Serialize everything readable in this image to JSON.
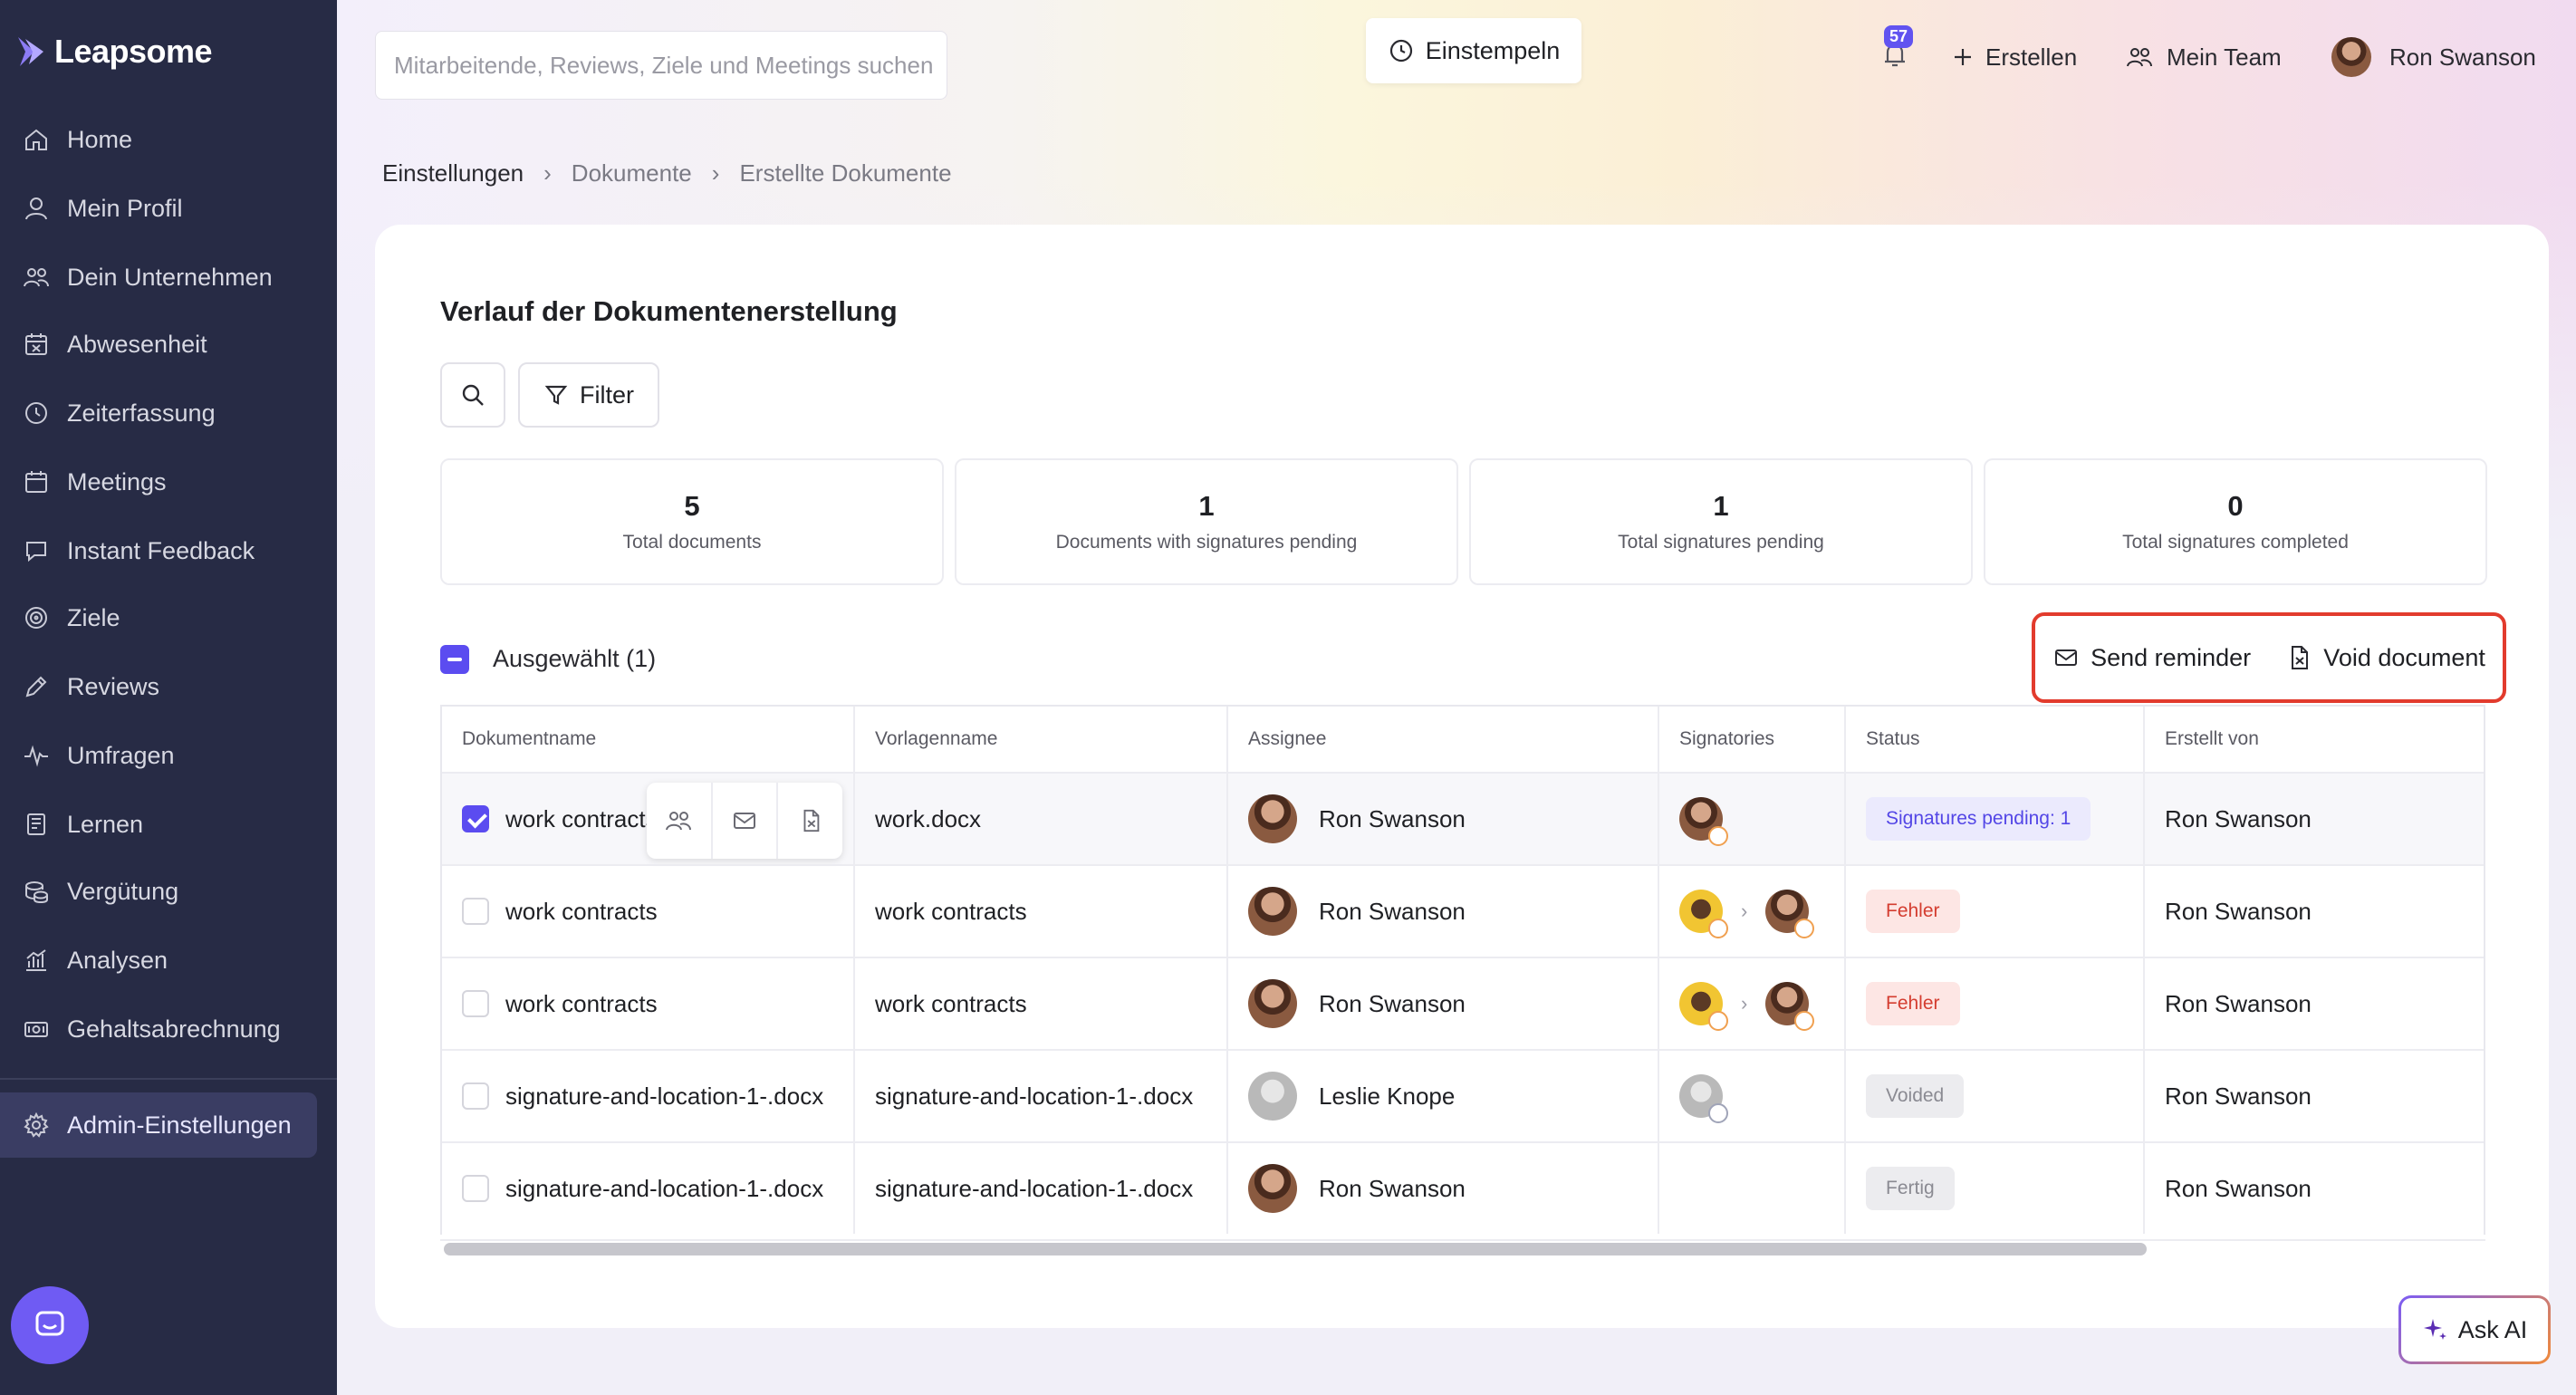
{
  "app": {
    "name": "Leapsome"
  },
  "sidebar": {
    "items": [
      {
        "label": "Home",
        "icon": "home-icon"
      },
      {
        "label": "Mein Profil",
        "icon": "user-icon"
      },
      {
        "label": "Dein Unternehmen",
        "icon": "users-icon"
      },
      {
        "label": "Abwesenheit",
        "icon": "calendar-x-icon"
      },
      {
        "label": "Zeiterfassung",
        "icon": "clock-icon"
      },
      {
        "label": "Meetings",
        "icon": "calendar-icon"
      },
      {
        "label": "Instant Feedback",
        "icon": "chat-icon"
      },
      {
        "label": "Ziele",
        "icon": "target-icon"
      },
      {
        "label": "Reviews",
        "icon": "pen-icon"
      },
      {
        "label": "Umfragen",
        "icon": "pulse-icon"
      },
      {
        "label": "Lernen",
        "icon": "book-icon"
      },
      {
        "label": "Vergütung",
        "icon": "coins-icon"
      },
      {
        "label": "Analysen",
        "icon": "chart-icon"
      },
      {
        "label": "Gehaltsabrechnung",
        "icon": "cash-icon"
      }
    ],
    "admin": {
      "label": "Admin-Einstellungen",
      "icon": "gear-icon"
    }
  },
  "topbar": {
    "search_placeholder": "Mitarbeitende, Reviews, Ziele und Meetings suchen",
    "clockin_label": "Einstempeln",
    "notifications_count": "57",
    "create_label": "Erstellen",
    "team_label": "Mein Team",
    "user_name": "Ron Swanson"
  },
  "breadcrumb": [
    "Einstellungen",
    "Dokumente",
    "Erstellte Dokumente"
  ],
  "page": {
    "title": "Verlauf der Dokumentenerstellung",
    "filter_label": "Filter",
    "stats": [
      {
        "value": "5",
        "label": "Total documents"
      },
      {
        "value": "1",
        "label": "Documents with signatures pending"
      },
      {
        "value": "1",
        "label": "Total signatures pending"
      },
      {
        "value": "0",
        "label": "Total signatures completed"
      }
    ],
    "selected_label": "Ausgewählt (1)",
    "send_reminder_label": "Send reminder",
    "void_document_label": "Void document"
  },
  "table": {
    "headers": [
      "Dokumentname",
      "Vorlagenname",
      "Assignee",
      "Signatories",
      "Status",
      "Erstellt von"
    ],
    "rows": [
      {
        "doc": "work contracts",
        "template": "work.docx",
        "assignee": "Ron Swanson",
        "status": "Signatures pending: 1",
        "status_kind": "pending",
        "creator": "Ron Swanson",
        "checked": true
      },
      {
        "doc": "work contracts",
        "template": "work contracts",
        "assignee": "Ron Swanson",
        "status": "Fehler",
        "status_kind": "error",
        "creator": "Ron Swanson",
        "checked": false
      },
      {
        "doc": "work contracts",
        "template": "work contracts",
        "assignee": "Ron Swanson",
        "status": "Fehler",
        "status_kind": "error",
        "creator": "Ron Swanson",
        "checked": false
      },
      {
        "doc": "signature-and-location-1-.docx",
        "template": "signature-and-location-1-.docx",
        "assignee": "Leslie Knope",
        "status": "Voided",
        "status_kind": "grey",
        "creator": "Ron Swanson",
        "checked": false
      },
      {
        "doc": "signature-and-location-1-.docx",
        "template": "signature-and-location-1-.docx",
        "assignee": "Ron Swanson",
        "status": "Fertig",
        "status_kind": "grey",
        "creator": "Ron Swanson",
        "checked": false
      }
    ]
  },
  "ask_ai_label": "Ask AI",
  "colors": {
    "sidebar": "#272b45",
    "accent": "#5b4cf0",
    "error": "#d43d30",
    "highlight": "#e23b2d"
  }
}
